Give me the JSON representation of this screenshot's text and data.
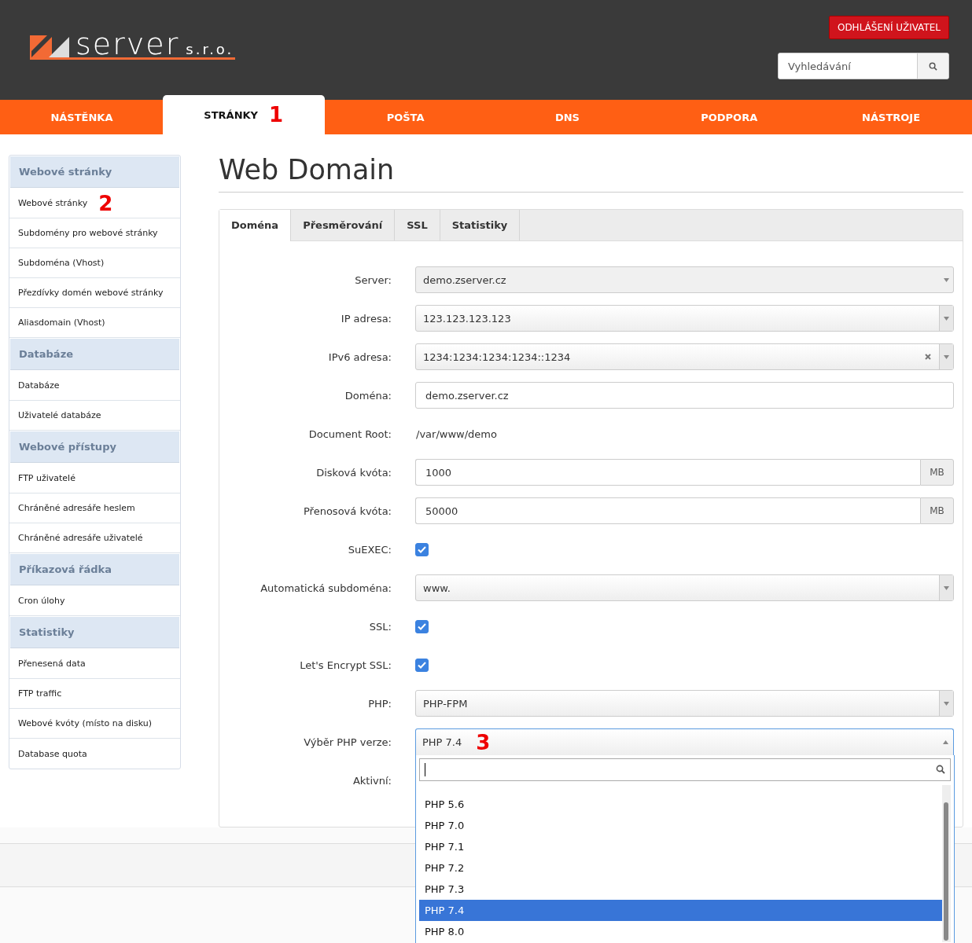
{
  "header": {
    "logo": {
      "name": "server",
      "suffix": "s.r.o."
    },
    "logout_button": "ODHLÁŠENÍ UŽIVATEL",
    "search": {
      "placeholder": "Vyhledávání"
    }
  },
  "nav": [
    {
      "label": "NÁSTĚNKA",
      "selected": false
    },
    {
      "label": "STRÁNKY",
      "selected": true,
      "marker": "1"
    },
    {
      "label": "POŠTA",
      "selected": false
    },
    {
      "label": "DNS",
      "selected": false
    },
    {
      "label": "PODPORA",
      "selected": false
    },
    {
      "label": "NÁSTROJE",
      "selected": false
    }
  ],
  "sidebar": [
    {
      "title": "Webové stránky",
      "items": [
        {
          "label": "Webové stránky",
          "marker": "2"
        },
        {
          "label": "Subdomény pro webové stránky"
        },
        {
          "label": "Subdoména (Vhost)"
        },
        {
          "label": "Přezdívky domén webové stránky"
        },
        {
          "label": "Aliasdomain (Vhost)"
        }
      ]
    },
    {
      "title": "Databáze",
      "items": [
        {
          "label": "Databáze"
        },
        {
          "label": "Uživatelé databáze"
        }
      ]
    },
    {
      "title": "Webové přístupy",
      "items": [
        {
          "label": "FTP uživatelé"
        },
        {
          "label": "Chráněné adresáře heslem"
        },
        {
          "label": "Chráněné adresáře uživatelé"
        }
      ]
    },
    {
      "title": "Příkazová řádka",
      "items": [
        {
          "label": "Cron úlohy"
        }
      ]
    },
    {
      "title": "Statistiky",
      "items": [
        {
          "label": "Přenesená data"
        },
        {
          "label": "FTP traffic"
        },
        {
          "label": "Webové kvóty (místo na disku)"
        },
        {
          "label": "Database quota"
        }
      ]
    }
  ],
  "page_title": "Web Domain",
  "tabs": [
    {
      "label": "Doména",
      "selected": true
    },
    {
      "label": "Přesměrování",
      "selected": false
    },
    {
      "label": "SSL",
      "selected": false
    },
    {
      "label": "Statistiky",
      "selected": false
    }
  ],
  "form": [
    {
      "kind": "select",
      "label": "Server:",
      "value": "demo.zserver.cz",
      "disabled": true,
      "clearable": false
    },
    {
      "kind": "select",
      "label": "IP adresa:",
      "value": "123.123.123.123",
      "disabled": false,
      "clearable": false
    },
    {
      "kind": "select",
      "label": "IPv6 adresa:",
      "value": "1234:1234:1234:1234::1234",
      "disabled": false,
      "clearable": true
    },
    {
      "kind": "input",
      "label": "Doména:",
      "value": "demo.zserver.cz"
    },
    {
      "kind": "static",
      "label": "Document Root:",
      "value": "/var/www/demo"
    },
    {
      "kind": "unit",
      "label": "Disková kvóta:",
      "value": "1000",
      "unit": "MB"
    },
    {
      "kind": "unit",
      "label": "Přenosová kvóta:",
      "value": "50000",
      "unit": "MB"
    },
    {
      "kind": "checkbox",
      "label": "SuEXEC:",
      "checked": true
    },
    {
      "kind": "select",
      "label": "Automatická subdoména:",
      "value": "www.",
      "disabled": false,
      "clearable": false
    },
    {
      "kind": "checkbox",
      "label": "SSL:",
      "checked": true
    },
    {
      "kind": "checkbox",
      "label": "Let's Encrypt SSL:",
      "checked": true
    },
    {
      "kind": "select",
      "label": "PHP:",
      "value": "PHP-FPM",
      "disabled": false,
      "clearable": false
    },
    {
      "kind": "open_select",
      "label": "Výběr PHP verze:",
      "value": "PHP 7.4",
      "marker": "3",
      "options": [
        {
          "label": "PHP 5.6",
          "selected": false
        },
        {
          "label": "PHP 7.0",
          "selected": false
        },
        {
          "label": "PHP 7.1",
          "selected": false
        },
        {
          "label": "PHP 7.2",
          "selected": false
        },
        {
          "label": "PHP 7.3",
          "selected": false
        },
        {
          "label": "PHP 7.4",
          "selected": true
        },
        {
          "label": "PHP 8.0",
          "selected": false
        }
      ]
    },
    {
      "kind": "covered",
      "label": "Aktivní:"
    }
  ]
}
